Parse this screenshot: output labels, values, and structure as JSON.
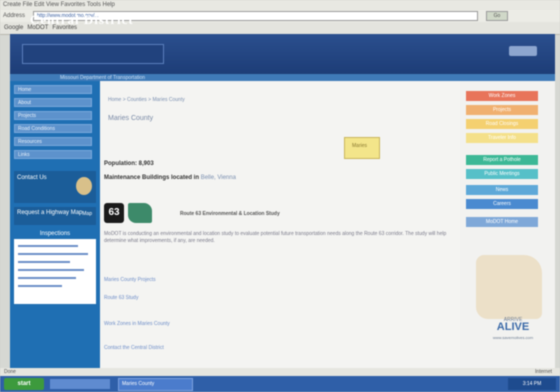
{
  "browser": {
    "menu_text": "Create  File  Edit  View  Favorites  Tools  Help",
    "address_label": "Address",
    "address_value": "http://www.modot.mo.gov/...",
    "go_label": "Go",
    "links": [
      "Google",
      "MoDOT",
      "Favorites"
    ],
    "status_text": "Done",
    "status_zone": "Internet"
  },
  "site": {
    "title": "Central District",
    "ribbon_text": "Missouri Department of Transportation"
  },
  "sidebar": {
    "nav_items": [
      "Home",
      "About",
      "Projects",
      "Road Conditions",
      "Resources",
      "Links"
    ],
    "contact_text": "Contact Us",
    "request_text": "Request a Highway Map",
    "request_label": "Map",
    "inspections_title": "Inspections"
  },
  "main": {
    "breadcrumb": "Home > Counties > Maries County",
    "county_title": "Maries County",
    "map_label": "Maries",
    "population": "Population: 8,903",
    "maintenance_label": "Maintenance Buildings located in",
    "maintenance_link": "Belle, Vienna",
    "shield_number": "63",
    "study_title": "Route 63 Environmental & Location Study",
    "paragraph": "MoDOT is conducting an environmental and location study to evaluate potential future transportation needs along the Route 63 corridor. The study will help determine what improvements, if any, are needed.",
    "links": [
      "Maries County Projects",
      "Route 63 Study",
      "Work Zones in Maries County",
      "Contact the Central District"
    ]
  },
  "right": {
    "buttons": [
      {
        "label": "Work Zones",
        "color": "#e8745a"
      },
      {
        "label": "Projects",
        "color": "#f0b070"
      },
      {
        "label": "Road Closings",
        "color": "#f4d070"
      },
      {
        "label": "Traveler Info",
        "color": "#f4e08a"
      },
      {
        "label": "Report a Pothole",
        "color": "#3cb896"
      },
      {
        "label": "Public Meetings",
        "color": "#56c0c8"
      },
      {
        "label": "News",
        "color": "#5ea8d8"
      },
      {
        "label": "Careers",
        "color": "#4a8ad0"
      },
      {
        "label": "MoDOT Home",
        "color": "#7fa8d8"
      }
    ],
    "alive_top": "ARRIVE",
    "alive_text": "ALIVE",
    "alive_url": "www.savemolives.com"
  },
  "taskbar": {
    "start_label": "start",
    "window_label": "Maries County",
    "clock": "3:14 PM"
  }
}
